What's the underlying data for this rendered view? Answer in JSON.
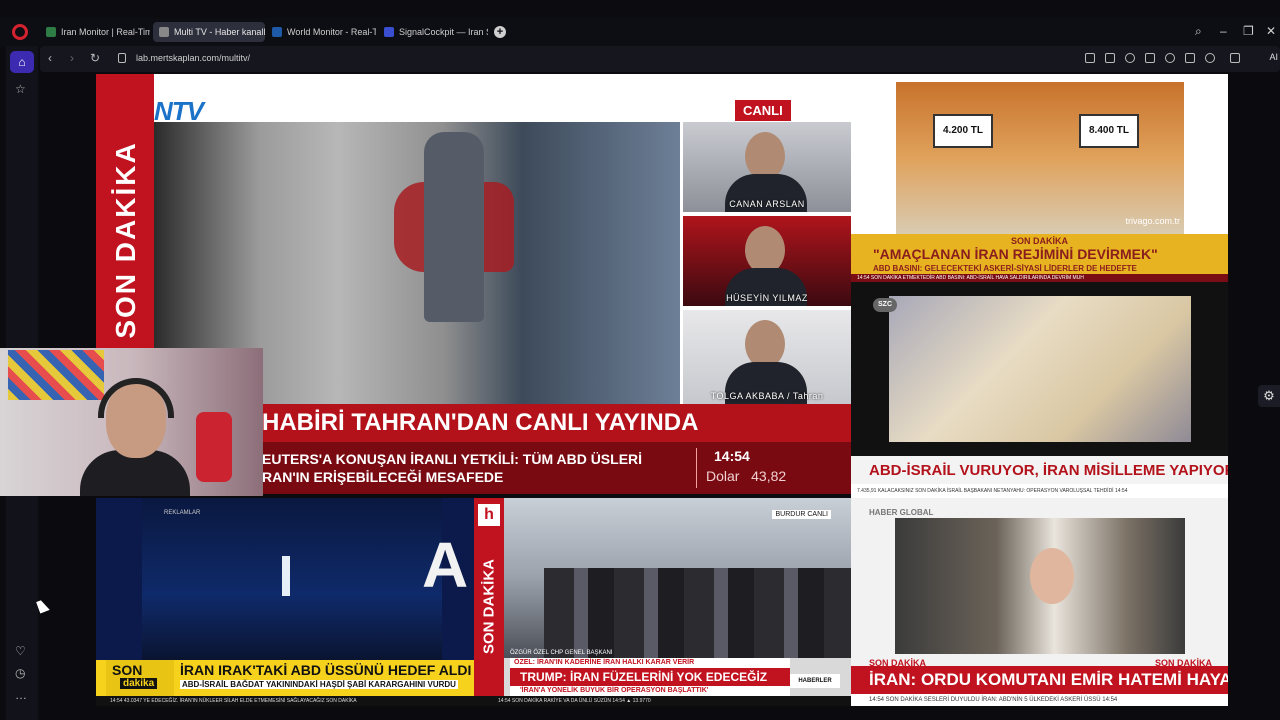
{
  "browser": {
    "tabs": [
      {
        "label": "Iran Monitor | Real-Time C",
        "active": false
      },
      {
        "label": "Multi TV - Haber kanallar",
        "active": true
      },
      {
        "label": "World Monitor - Real-Tim",
        "active": false
      },
      {
        "label": "SignalCockpit — Iran Situ",
        "active": false
      }
    ],
    "url": "lab.mertskaplan.com/multitv/",
    "ai_label": "AI",
    "colors": {
      "accent": "#3c2bb0",
      "opera": "#d4232f"
    }
  },
  "ntv": {
    "logo": "NTV",
    "live_badge": "CANLI",
    "vertical_banner": "SON DAKİKA",
    "guests": [
      "CANAN ARSLAN",
      "HÜSEYİN YILMAZ",
      "TOLGA AKBABA / Tahran"
    ],
    "headline": "HABİRİ TAHRAN'DAN CANLI YAYINDA",
    "subline_1": "EUTERS'A KONUŞAN İRANLI YETKİLİ: TÜM ABD ÜSLERİ",
    "subline_2": "RAN'IN ERİŞEBİLECEĞİ MESAFEDE",
    "time": "14:54",
    "dolar_label": "Dolar",
    "dolar_value": "43,82"
  },
  "trivago": {
    "price_1": "4.200 TL",
    "price_2": "8.400 TL",
    "domain": "trivago.com.tr"
  },
  "news2": {
    "breaking": "SON DAKİKA",
    "headline": "\"AMAÇLANAN İRAN REJİMİNİ DEVİRMEK\"",
    "sub": "ABD BASINI: GELECEKTEKİ ASKERİ-SİYASİ LİDERLER DE HEDEFTE",
    "strip": "14:54  SON DAKİKA  ETMEKTEDİR  ABD BASINI: ABD-İSRAİL HAVA SALDIRILARINDA DEVRİM MUH",
    "logo": "SZC",
    "bottom_headline": "ABD-İSRAİL VURUYOR, İRAN MİSİLLEME YAPIYOR",
    "bottom_strip": "7.435,91  KALACAKSINIZ  SON DAKİKA  İSRAİL BAŞBAKANI NETANYAHU: OPERASYON VAROLUŞSAL TEHDİDİ  14:54"
  },
  "blue": {
    "ads_label": "REKLAMLAR",
    "big_letter": "A",
    "son": "SON",
    "dakika": "dakika",
    "headline": "İRAN IRAK'TAKİ ABD ÜSSÜNÜ HEDEF ALDI",
    "sub": "ABD-İSRAİL BAĞDAT YAKININDAKİ HAŞDİ ŞABİ KARARGAHINI VURDU",
    "strip": "14:54  43.0347  YE EDECEĞİZ. İRAN'IN NÜKLEER SİLAH ELDE ETMEMESİNİ SAĞLAYACAĞIZ  SON DAKİKA"
  },
  "halk": {
    "logo": "h",
    "live": "BURDUR  CANLI",
    "vertical_banner": "SON DAKİKA",
    "speaker": "ÖZGÜR ÖZEL  CHP GENEL BAŞKANI",
    "sub_top": "ÖZEL: İRAN'IN KADERİNE İRAN HALKI KARAR VERİR",
    "headline": "TRUMP: İRAN FÜZELERİNİ YOK EDECEĞİZ",
    "sub_bottom": "'İRAN'A YÖNELİK BÜYÜK BİR OPERASYON BAŞLATTIK'",
    "tag": "HABERLER",
    "strip": "14:54  SON DAKİKA  RAKİYE VA DA ÜNLÜ SÜZÜN  14:54  ▲ 13.9770"
  },
  "haber": {
    "logo": "HABER GLOBAL",
    "breaking_left": "SON DAKİKA",
    "breaking_right": "SON DAKİKA",
    "headline": "İRAN: ORDU KOMUTANI EMİR HATEMİ HAYATTA",
    "strip": "14:54  SON DAKİKA  SESLERİ DUYULDU  İRAN: ABD'NİN 5 ÜLKEDEKİ ASKERİ ÜSSÜ  14:54"
  }
}
